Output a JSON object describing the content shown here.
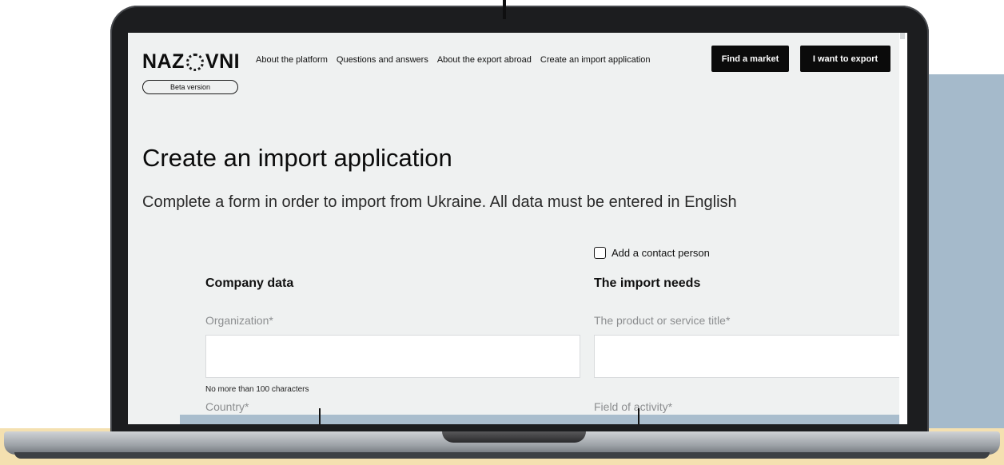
{
  "header": {
    "logo": "NAZ○VNI",
    "logo_parts": {
      "left": "NAZ",
      "right": "VNI"
    },
    "nav": [
      "About the platform",
      "Questions and answers",
      "About the export abroad",
      "Create an import application"
    ],
    "find_market": "Find a market",
    "want_export": "I want to export",
    "beta": "Beta version"
  },
  "page": {
    "title": "Create an import application",
    "subtitle": "Complete a form in order to import from Ukraine. All data must be entered in English"
  },
  "form": {
    "contact_checkbox_label": "Add a contact person",
    "contact_checked": false,
    "company_section": "Company data",
    "needs_section": "The import needs",
    "organization_label": "Organization*",
    "organization_value": "",
    "organization_hint": "No more than 100 characters",
    "country_label": "Country*",
    "product_label": "The product or service title*",
    "product_value": "",
    "field_label": "Field of activity*"
  },
  "colors": {
    "screen_bg": "#eff1f1",
    "button_dark": "#0b0b0b",
    "backdrop_blue": "#a5bacb",
    "backdrop_cream": "#f4e0b0"
  }
}
